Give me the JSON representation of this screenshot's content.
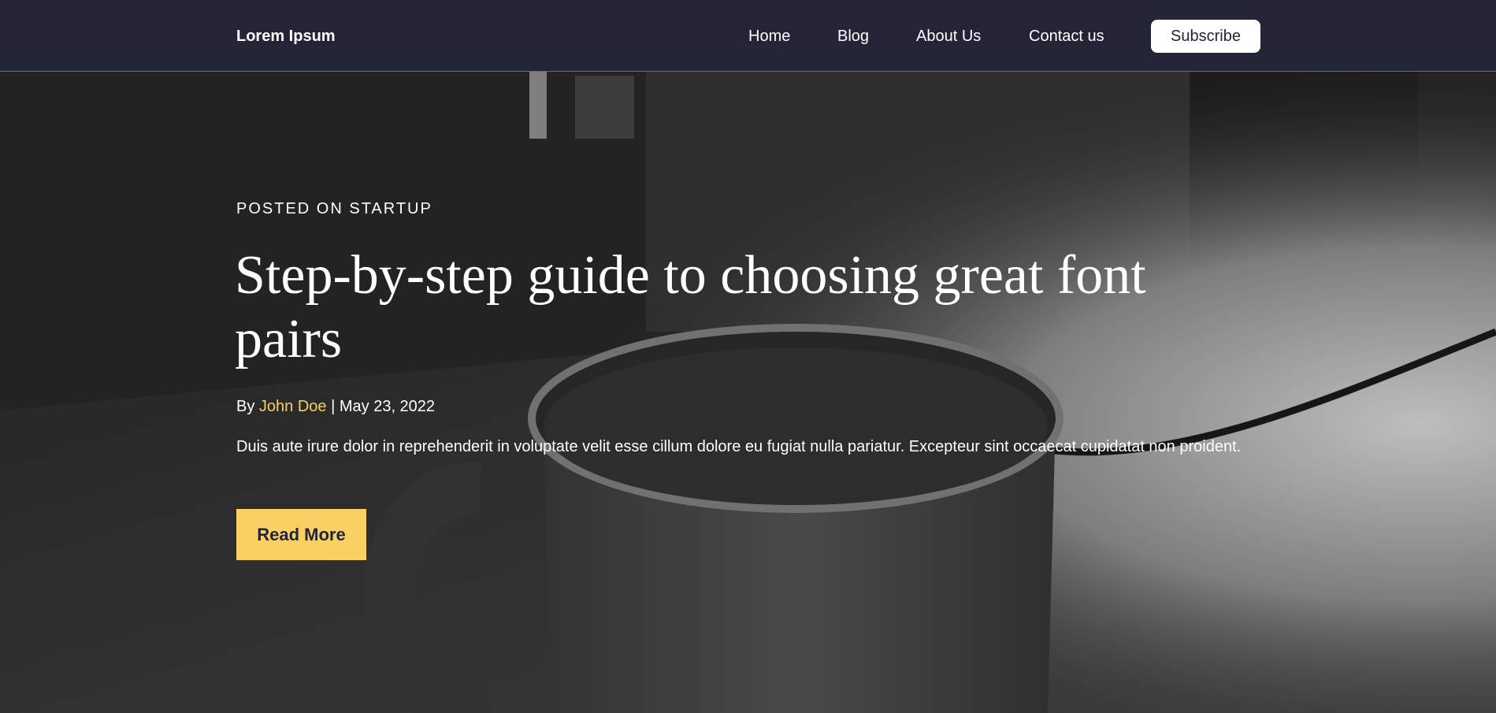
{
  "nav": {
    "brand": "Lorem Ipsum",
    "links": [
      "Home",
      "Blog",
      "About Us",
      "Contact us"
    ],
    "subscribe_label": "Subscribe"
  },
  "hero": {
    "category": "POSTED ON STARTUP",
    "title": "Step-by-step guide to choosing great font pairs",
    "byline_prefix": "By",
    "author": "John Doe",
    "separator": "|",
    "date": "May 23, 2022",
    "excerpt": "Duis aute irure dolor in reprehenderit in voluptate velit esse cillum dolore eu fugiat nulla pariatur. Excepteur sint occaecat cupidatat non proident.",
    "read_more_label": "Read More",
    "background_image": "mug-photo"
  },
  "colors": {
    "nav_bg": "#232537",
    "accent": "#f8d064",
    "author_link": "#f5d060",
    "text_light": "#ffffff"
  }
}
